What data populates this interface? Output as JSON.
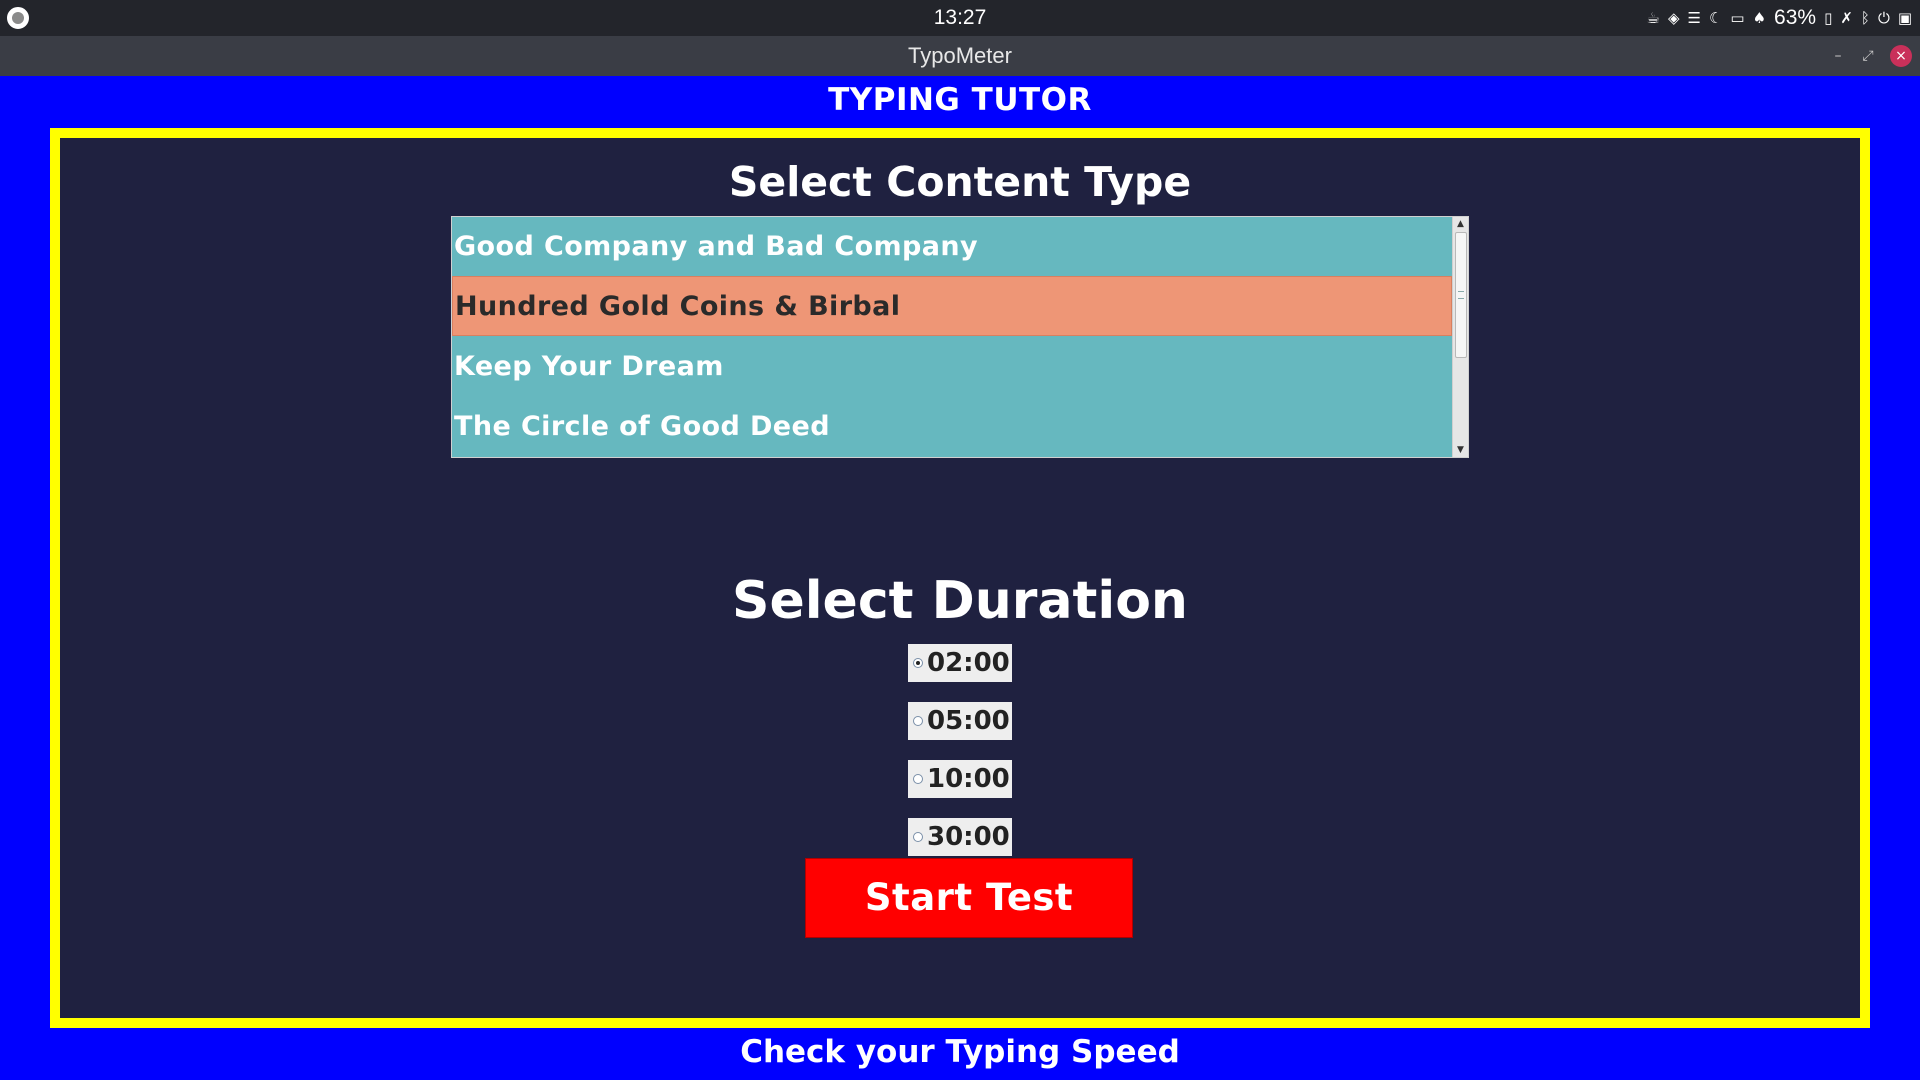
{
  "system_bar": {
    "clock": "13:27",
    "battery_percent": "63%"
  },
  "window": {
    "title": "TypoMeter",
    "close_glyph": "×"
  },
  "app": {
    "heading": "TYPING TUTOR",
    "content_section_title": "Select Content Type",
    "content_items": [
      {
        "label": "Good Company and Bad Company",
        "selected": false
      },
      {
        "label": "Hundred Gold Coins & Birbal",
        "selected": true
      },
      {
        "label": "Keep Your Dream",
        "selected": false
      },
      {
        "label": "The Circle of Good Deed",
        "selected": false
      }
    ],
    "duration_section_title": "Select Duration",
    "durations": [
      {
        "label": "02:00",
        "checked": true
      },
      {
        "label": "05:00",
        "checked": false
      },
      {
        "label": "10:00",
        "checked": false
      },
      {
        "label": "30:00",
        "checked": false
      }
    ],
    "start_button_label": "Start Test",
    "footer": "Check your Typing Speed"
  },
  "colors": {
    "background": "#0000ff",
    "panel": "#1f2140",
    "panel_border": "#ffff00",
    "list_bg": "#66b8bf",
    "list_selected": "#ee9676",
    "start_button": "#ff0000"
  }
}
